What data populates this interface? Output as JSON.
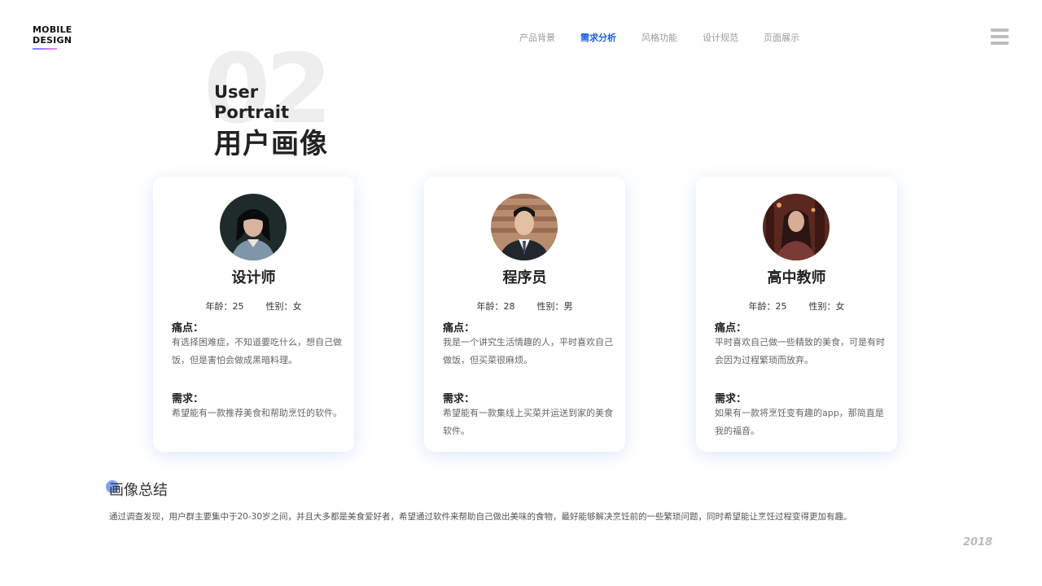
{
  "logo": {
    "line1": "MOBILE",
    "line2": "DESIGN"
  },
  "nav": {
    "items": [
      {
        "label": "产品背景",
        "active": false
      },
      {
        "label": "需求分析",
        "active": true
      },
      {
        "label": "风格功能",
        "active": false
      },
      {
        "label": "设计规范",
        "active": false
      },
      {
        "label": "页面展示",
        "active": false
      }
    ],
    "active_color": "#1d5fe0"
  },
  "menu_icon": "hamburger-menu-icon",
  "heading": {
    "number": "02",
    "en_line1": "User",
    "en_line2": "Portrait",
    "cn_title": "用户画像"
  },
  "personas": [
    {
      "role": "设计师",
      "age_label": "年龄：",
      "age": "25",
      "gender_label": "性别：",
      "gender": "女",
      "pain_label": "痛点：",
      "pain": "有选择困难症，不知道要吃什么，想自己做饭，但是害怕会做成黑暗料理。",
      "need_label": "需求：",
      "need": "希望能有一款推荐美食和帮助烹饪的软件。"
    },
    {
      "role": "程序员",
      "age_label": "年龄：",
      "age": "28",
      "gender_label": "性别：",
      "gender": "男",
      "pain_label": "痛点：",
      "pain": "我是一个讲究生活情趣的人，平时喜欢自己做饭，但买菜很麻烦。",
      "need_label": "需求：",
      "need": "希望能有一款集线上买菜并运送到家的美食软件。"
    },
    {
      "role": "高中教师",
      "age_label": "年龄：",
      "age": "25",
      "gender_label": "性别：",
      "gender": "女",
      "pain_label": "痛点：",
      "pain": "平时喜欢自己做一些精致的美食，可是有时会因为过程繁琐而放弃。",
      "need_label": "需求：",
      "need": "如果有一款将烹饪变有趣的app，那简直是我的福音。"
    }
  ],
  "summary": {
    "title": "画像总结",
    "text": "通过调查发现，用户群主要集中于20-30岁之间，并且大多都是美食爱好者，希望通过软件来帮助自己做出美味的食物，最好能够解决烹饪前的一些繁琐问题，同时希望能让烹饪过程变得更加有趣。"
  },
  "year": "2018"
}
